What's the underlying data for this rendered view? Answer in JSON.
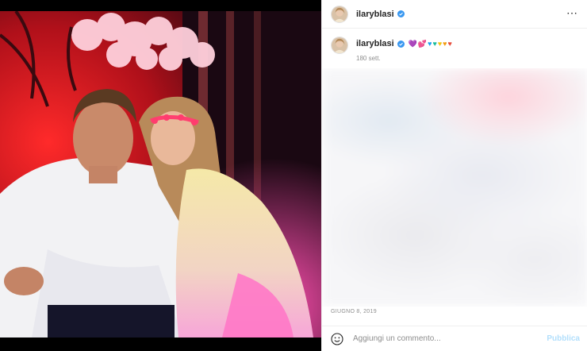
{
  "post": {
    "username": "ilaryblasi",
    "verified": true,
    "more_icon": "more-options-icon",
    "caption": {
      "username": "ilaryblasi",
      "hearts": [
        {
          "glyph": "💜",
          "color": "#9b59d0"
        },
        {
          "glyph": "💕",
          "color": "#e84393"
        },
        {
          "glyph": "♥",
          "color": "#1da1f2"
        },
        {
          "glyph": "♥",
          "color": "#1abc9c"
        },
        {
          "glyph": "♥",
          "color": "#f1c40f"
        },
        {
          "glyph": "♥",
          "color": "#f39c12"
        },
        {
          "glyph": "♥",
          "color": "#e74c3c"
        }
      ],
      "time_ago": "180 sett."
    },
    "date": "GIUGNO 8, 2019"
  },
  "comment": {
    "placeholder": "Aggiungi un commento...",
    "publish_label": "Pubblica",
    "emoji_icon": "emoji-smile-icon"
  },
  "colors": {
    "verified": "#3897f0",
    "publish_disabled": "#b2dffc",
    "muted_text": "#8e8e8e"
  }
}
